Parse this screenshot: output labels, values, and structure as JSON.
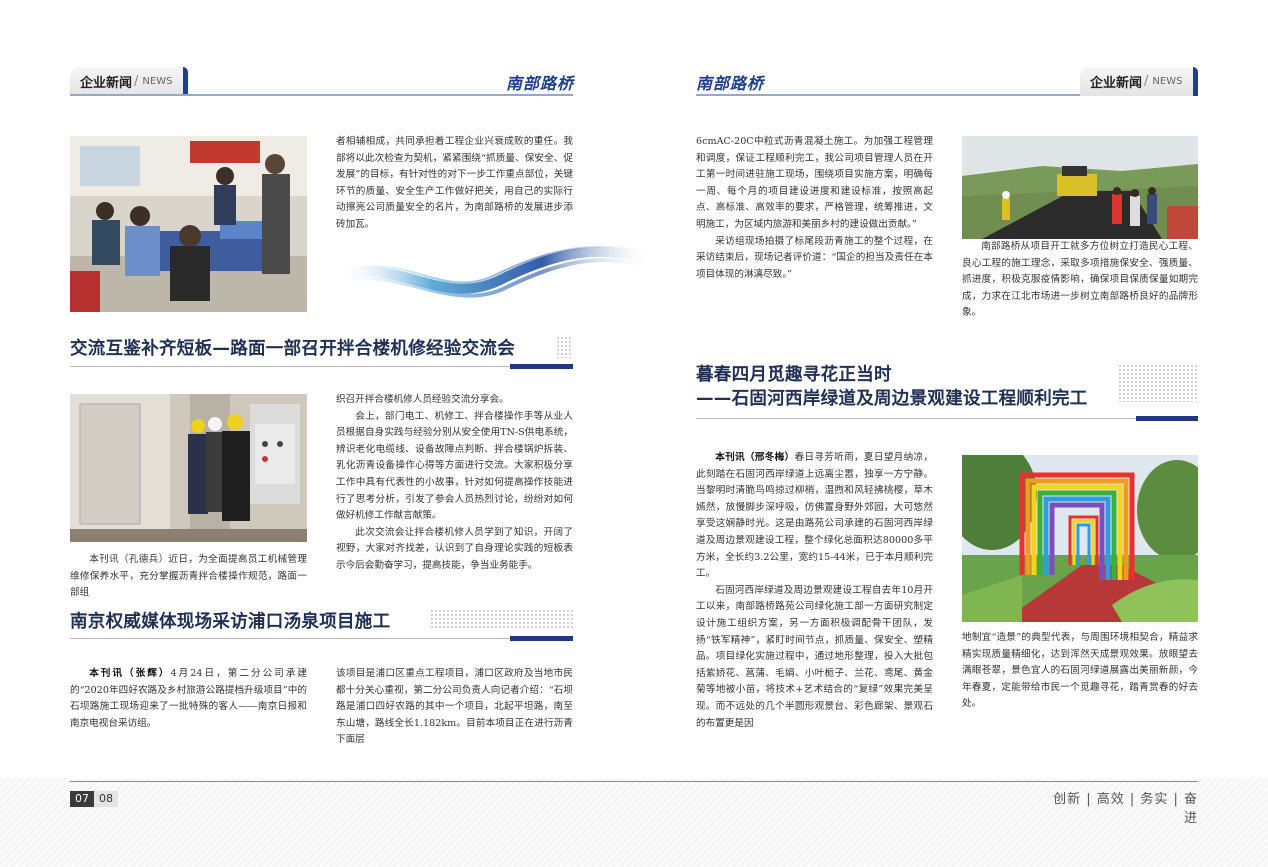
{
  "left_page": {
    "header": {
      "section_cn": "企业新闻",
      "section_en": "NEWS",
      "logo": "南部路桥"
    },
    "article_intro_text": "者相辅相成，共同承担着工程企业兴衰成败的重任。我部将以此次检查为契机，紧紧围绕“抓质量、保安全、促发展”的目标，有针对性的对下一步工作重点部位，关键环节的质量、安全生产工作做好把关，用自己的实际行动擦亮公司质量安全的名片，为南部路桥的发展进步添砖加瓦。",
    "article2": {
      "title": "交流互鉴补齐短板—路面一部召开拌合楼机修经验交流会",
      "caption": "本刊讯（孔德兵）近日，为全面提高员工机械管理维修保养水平，充分掌握沥青拌合楼操作规范，路面一部组",
      "p1": "织召开拌合楼机修人员经验交流分享会。",
      "p2": "会上，部门电工、机修工、拌合楼操作手等从业人员根据自身实践与经验分别从安全使用TN-S供电系统，辨识老化电缆线、设备故障点判断、拌合楼锅炉拆装、乳化沥青设备操作心得等方面进行交流。大家积极分享工作中具有代表性的小故事，针对如何提高操作技能进行了思考分析，引发了参会人员热烈讨论，纷纷对如何做好机修工作献言献策。",
      "p3": "此次交流会让拌合楼机修人员学到了知识，开阔了视野，大家对齐找差，认识到了自身理论实践的短板表示今后会勤奋学习，提高技能，争当业务能手。"
    },
    "article3": {
      "title": "南京权威媒体现场采访浦口汤泉项目施工",
      "col1": "4月24日，第二分公司承建的“2020年四好农路及乡村旅游公路提档升级项目”中的石坝路施工现场迎来了一批特殊的客人——南京日报和南京电视台采访组。",
      "byline": "本刊讯（张辉）",
      "col2": "该项目是浦口区重点工程项目，浦口区政府及当地市民都十分关心重视，第二分公司负责人向记者介绍：“石坝路是浦口四好农路的其中一个项目，北起平坦路，南至东山塘，路线全长1.182km。目前本项目正在进行沥青下面层"
    },
    "page_number": "07"
  },
  "right_page": {
    "header": {
      "section_cn": "企业新闻",
      "section_en": "NEWS",
      "logo": "南部路桥"
    },
    "top_col1": "6cmAC-20C中粒式沥青混凝土施工。为加强工程管理和调度，保证工程顺利完工，我公司项目管理人员在开工第一时间进驻施工现场，围绕项目实施方案，明确每一周、每个月的项目建设进度和建设标准，按照高起点、高标准、高效率的要求，严格管理，统筹推进，文明施工，为区域内旅游和美丽乡村的建设做出贡献。”",
    "top_col1_p2": "采访组现场拍摄了标尾段沥青施工的整个过程，在采访结束后，现场记者评价道：“国企的担当及责任在本项目体现的淋漓尽致。”",
    "top_caption": "南部路桥从项目开工就多方位树立打造民心工程、良心工程的施工理念，采取多项措施保安全、强质量、抓进度，积极克服疫情影响，确保项目保质保量如期完成，力求在江北市场进一步树立南部路桥良好的品牌形象。",
    "article4": {
      "title_line1": "暮春四月觅趣寻花正当时",
      "title_line2": "——石固河西岸绿道及周边景观建设工程顺利完工",
      "byline": "本刊讯（邢冬梅）",
      "p1": "春日寻芳听雨，夏日望月纳凉，此刻踏在石固河西岸绿道上远离尘嚣，独享一方宁静。当黎明时清脆鸟鸣掠过柳梢，温煦和风轻拂桃樱，草木嫣然，放慢脚步深呼吸，仿佛置身野外郊园，大可悠然享受这娴静时光。这是由路苑公司承建的石固河西岸绿道及周边景观建设工程，整个绿化总面积达80000多平方米，全长约3.2公里，宽约15-44米，已于本月顺利完工。",
      "p2": "石固河西岸绿道及周边景观建设工程自去年10月开工以来，南部路桥路苑公司绿化施工部一方面研究制定设计施工组织方案，另一方面积极调配骨干团队，发扬“铁军精神”，紧盯时间节点，抓质量、保安全、塑精品。项目绿化实施过程中，通过地形整理，投入大批包括紫娇花、菖蒲、毛娟、小叶栀子、兰花、鸢尾、黄金菊等地被小苗，将技术+艺术结合的“复绿”效果完美呈现。而不远处的几个半圆形观景台、彩色廊架、景观石的布置更是因",
      "col2": "地制宜“造景”的典型代表，与周围环境相契合，精益求精实现质量精细化，达到浑然天成景观效果。放眼望去满眼苍翠，景色宜人的石固河绿道展露出美丽新颜，今年春夏，定能带给市民一个觅趣寻花，踏青赏春的好去处。"
    },
    "page_number": "08",
    "slogan": "创新 | 高效 | 务实 | 奋进"
  },
  "colors": {
    "brand_blue": "#1d3f8e",
    "title_navy": "#1f2f55",
    "rule_blue": "#22377e"
  }
}
